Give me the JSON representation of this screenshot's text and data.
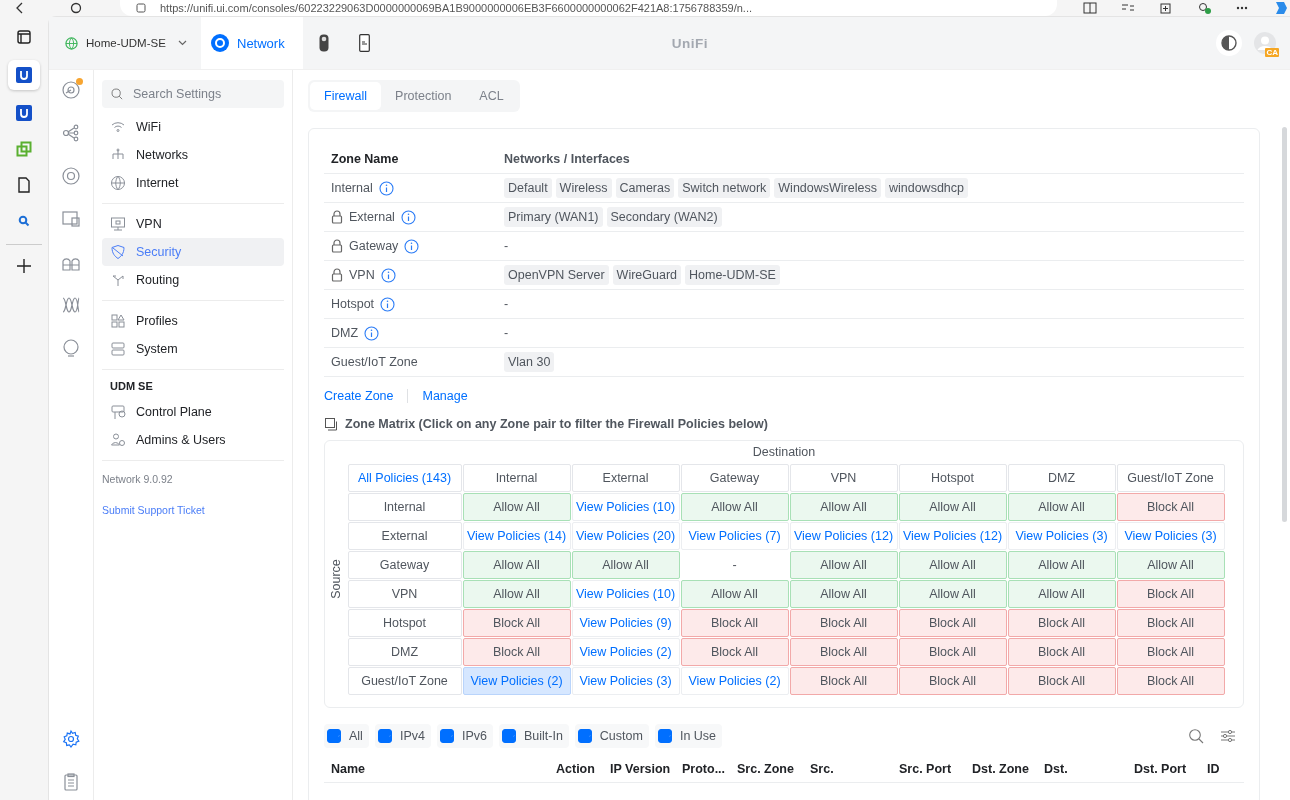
{
  "browser": {
    "url": "https://unifi.ui.com/consoles/60223229063D0000000069BA1B9000000006EB3F6600000000062F421A8:1756788359/n...",
    "sidebar": [
      {
        "kind": "tabs",
        "selected": false
      },
      {
        "kind": "unifi",
        "selected": true
      },
      {
        "kind": "unifi",
        "selected": false
      },
      {
        "kind": "puzzle",
        "selected": false
      },
      {
        "kind": "page",
        "selected": false
      },
      {
        "kind": "search",
        "selected": false
      },
      {
        "kind": "plus",
        "selected": false
      }
    ]
  },
  "header": {
    "site": "Home-UDM-SE",
    "apps": [
      {
        "kind": "network",
        "label": "Network",
        "selected": true
      },
      {
        "kind": "camera",
        "selected": false
      },
      {
        "kind": "access",
        "selected": false
      }
    ],
    "logo": "UniFi",
    "avatar_badge": "CA"
  },
  "rail": [
    {
      "kind": "dashboard",
      "alert": true,
      "selected": false
    },
    {
      "kind": "topology",
      "alert": false,
      "selected": false
    },
    {
      "kind": "devices",
      "alert": false,
      "selected": false
    },
    {
      "kind": "clients",
      "alert": false,
      "selected": false
    },
    {
      "kind": "ports",
      "alert": false,
      "selected": false
    },
    {
      "kind": "insights",
      "alert": false,
      "selected": false
    },
    {
      "kind": "bulb",
      "alert": false,
      "selected": false
    },
    {
      "kind": "settings",
      "alert": false,
      "selected": true
    },
    {
      "kind": "log",
      "alert": false,
      "selected": false
    }
  ],
  "settings_nav": {
    "search": {
      "placeholder": "Search Settings"
    },
    "groups": [
      {
        "items": [
          {
            "kind": "wifi",
            "label": "WiFi",
            "selected": false
          },
          {
            "kind": "networks",
            "label": "Networks",
            "selected": false
          },
          {
            "kind": "internet",
            "label": "Internet",
            "selected": false
          }
        ]
      },
      {
        "items": [
          {
            "kind": "vpn",
            "label": "VPN",
            "selected": false
          },
          {
            "kind": "security",
            "label": "Security",
            "selected": true
          },
          {
            "kind": "routing",
            "label": "Routing",
            "selected": false
          }
        ]
      },
      {
        "items": [
          {
            "kind": "profiles",
            "label": "Profiles",
            "selected": false
          },
          {
            "kind": "system",
            "label": "System",
            "selected": false
          }
        ]
      },
      {
        "title": "UDM SE",
        "items": [
          {
            "kind": "control",
            "label": "Control Plane",
            "selected": false
          },
          {
            "kind": "admins",
            "label": "Admins & Users",
            "selected": false
          }
        ]
      }
    ],
    "version": "Network 9.0.92",
    "support_link": "Submit Support Ticket"
  },
  "tabs": [
    {
      "label": "Firewall",
      "selected": true
    },
    {
      "label": "Protection",
      "selected": false
    },
    {
      "label": "ACL",
      "selected": false
    }
  ],
  "zones": {
    "columns": [
      "Zone Name",
      "Networks / Interfaces"
    ],
    "rows": [
      {
        "name": "Internal",
        "locked": false,
        "info": true,
        "networks": [
          "Default",
          "Wireless",
          "Cameras",
          "Switch network",
          "WindowsWireless",
          "windowsdhcp"
        ]
      },
      {
        "name": "External",
        "locked": true,
        "info": true,
        "networks": [
          "Primary (WAN1)",
          "Secondary (WAN2)"
        ]
      },
      {
        "name": "Gateway",
        "locked": true,
        "info": true,
        "empty": "-"
      },
      {
        "name": "VPN",
        "locked": true,
        "info": true,
        "networks": [
          "OpenVPN Server",
          "WireGuard",
          "Home-UDM-SE"
        ]
      },
      {
        "name": "Hotspot",
        "locked": false,
        "info": true,
        "empty": "-"
      },
      {
        "name": "DMZ",
        "locked": false,
        "info": true,
        "empty": "-"
      },
      {
        "name": "Guest/IoT Zone",
        "locked": false,
        "info": false,
        "networks": [
          "Vlan 30"
        ]
      }
    ],
    "links": [
      "Create Zone",
      "Manage"
    ]
  },
  "matrix": {
    "title": "Zone Matrix (Click on any Zone pair to filter the Firewall Policies below)",
    "destination_label": "Destination",
    "source_label": "Source",
    "all_link": "All Policies (143)",
    "columns": [
      "Internal",
      "External",
      "Gateway",
      "VPN",
      "Hotspot",
      "DMZ",
      "Guest/IoT Zone"
    ],
    "rows": [
      {
        "source": "Internal",
        "cells": [
          {
            "kind": "allow",
            "text": "Allow All",
            "selected": false
          },
          {
            "kind": "view",
            "text": "View Policies (10)",
            "selected": false
          },
          {
            "kind": "allow",
            "text": "Allow All",
            "selected": false
          },
          {
            "kind": "allow",
            "text": "Allow All",
            "selected": false
          },
          {
            "kind": "allow",
            "text": "Allow All",
            "selected": false
          },
          {
            "kind": "allow",
            "text": "Allow All",
            "selected": false
          },
          {
            "kind": "block",
            "text": "Block All",
            "selected": false
          }
        ]
      },
      {
        "source": "External",
        "cells": [
          {
            "kind": "view",
            "text": "View Policies (14)",
            "selected": false
          },
          {
            "kind": "view",
            "text": "View Policies (20)",
            "selected": false
          },
          {
            "kind": "view",
            "text": "View Policies (7)",
            "selected": false
          },
          {
            "kind": "view",
            "text": "View Policies (12)",
            "selected": false
          },
          {
            "kind": "view",
            "text": "View Policies (12)",
            "selected": false
          },
          {
            "kind": "view",
            "text": "View Policies (3)",
            "selected": false
          },
          {
            "kind": "view",
            "text": "View Policies (3)",
            "selected": false
          }
        ]
      },
      {
        "source": "Gateway",
        "cells": [
          {
            "kind": "allow",
            "text": "Allow All",
            "selected": false
          },
          {
            "kind": "allow",
            "text": "Allow All",
            "selected": false
          },
          {
            "kind": "none",
            "text": "-",
            "selected": false
          },
          {
            "kind": "allow",
            "text": "Allow All",
            "selected": false
          },
          {
            "kind": "allow",
            "text": "Allow All",
            "selected": false
          },
          {
            "kind": "allow",
            "text": "Allow All",
            "selected": false
          },
          {
            "kind": "allow",
            "text": "Allow All",
            "selected": false
          }
        ]
      },
      {
        "source": "VPN",
        "cells": [
          {
            "kind": "allow",
            "text": "Allow All",
            "selected": false
          },
          {
            "kind": "view",
            "text": "View Policies (10)",
            "selected": false
          },
          {
            "kind": "allow",
            "text": "Allow All",
            "selected": false
          },
          {
            "kind": "allow",
            "text": "Allow All",
            "selected": false
          },
          {
            "kind": "allow",
            "text": "Allow All",
            "selected": false
          },
          {
            "kind": "allow",
            "text": "Allow All",
            "selected": false
          },
          {
            "kind": "block",
            "text": "Block All",
            "selected": false
          }
        ]
      },
      {
        "source": "Hotspot",
        "cells": [
          {
            "kind": "block",
            "text": "Block All",
            "selected": false
          },
          {
            "kind": "view",
            "text": "View Policies (9)",
            "selected": false
          },
          {
            "kind": "block",
            "text": "Block All",
            "selected": false
          },
          {
            "kind": "block",
            "text": "Block All",
            "selected": false
          },
          {
            "kind": "block",
            "text": "Block All",
            "selected": false
          },
          {
            "kind": "block",
            "text": "Block All",
            "selected": false
          },
          {
            "kind": "block",
            "text": "Block All",
            "selected": false
          }
        ]
      },
      {
        "source": "DMZ",
        "cells": [
          {
            "kind": "block",
            "text": "Block All",
            "selected": false
          },
          {
            "kind": "view",
            "text": "View Policies (2)",
            "selected": false
          },
          {
            "kind": "block",
            "text": "Block All",
            "selected": false
          },
          {
            "kind": "block",
            "text": "Block All",
            "selected": false
          },
          {
            "kind": "block",
            "text": "Block All",
            "selected": false
          },
          {
            "kind": "block",
            "text": "Block All",
            "selected": false
          },
          {
            "kind": "block",
            "text": "Block All",
            "selected": false
          }
        ]
      },
      {
        "source": "Guest/IoT Zone",
        "cells": [
          {
            "kind": "view",
            "text": "View Policies (2)",
            "selected": true
          },
          {
            "kind": "view",
            "text": "View Policies (3)",
            "selected": false
          },
          {
            "kind": "view",
            "text": "View Policies (2)",
            "selected": false
          },
          {
            "kind": "block",
            "text": "Block All",
            "selected": false
          },
          {
            "kind": "block",
            "text": "Block All",
            "selected": false
          },
          {
            "kind": "block",
            "text": "Block All",
            "selected": false
          },
          {
            "kind": "block",
            "text": "Block All",
            "selected": false
          }
        ]
      }
    ]
  },
  "filters": [
    {
      "label": "All",
      "checked": true
    },
    {
      "label": "IPv4",
      "checked": true
    },
    {
      "label": "IPv6",
      "checked": true
    },
    {
      "label": "Built-In",
      "checked": true
    },
    {
      "label": "Custom",
      "checked": true
    },
    {
      "label": "In Use",
      "checked": true
    }
  ],
  "policies": {
    "columns": [
      "Name",
      "Action",
      "IP Version",
      "Proto...",
      "Src. Zone",
      "Src.",
      "Src. Port",
      "Dst. Zone",
      "Dst.",
      "Dst. Port",
      "ID"
    ]
  }
}
